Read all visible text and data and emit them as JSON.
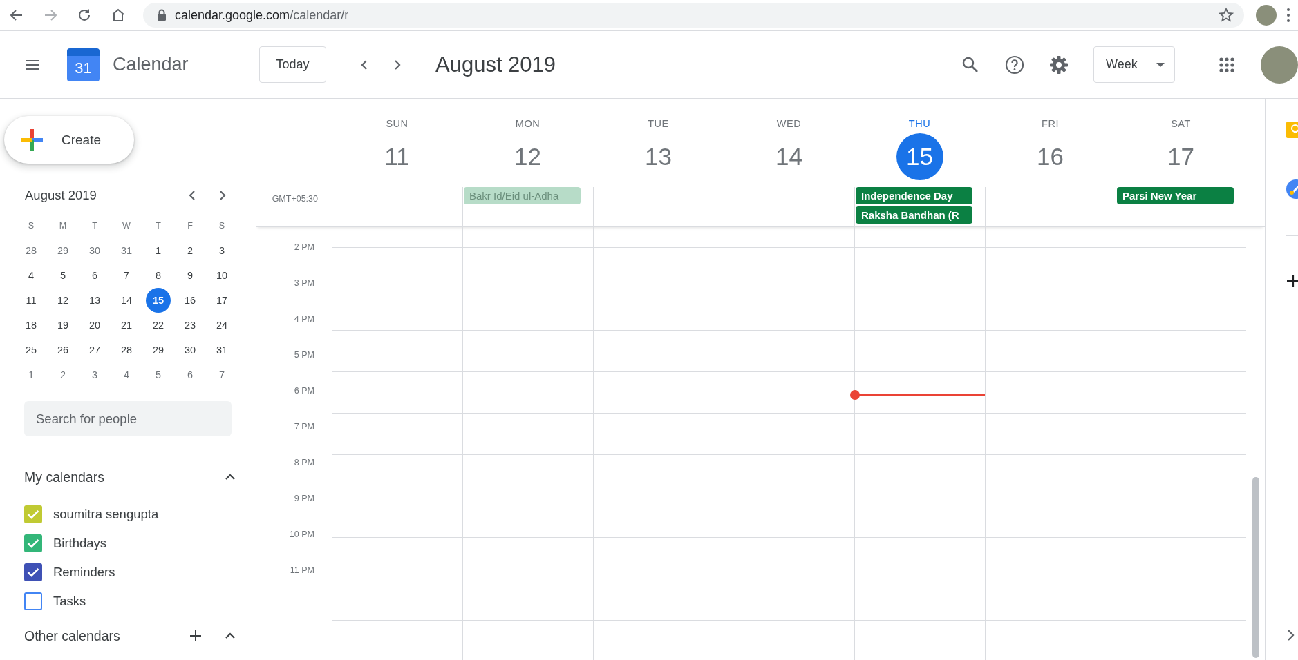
{
  "browser": {
    "url_host": "calendar.google.com",
    "url_path": "/calendar/r"
  },
  "header": {
    "logo_day": "31",
    "app_name": "Calendar",
    "today_button": "Today",
    "title": "August 2019",
    "view": "Week"
  },
  "sidebar": {
    "create_button": "Create",
    "mini_calendar": {
      "title": "August 2019",
      "weekdays": [
        "S",
        "M",
        "T",
        "W",
        "T",
        "F",
        "S"
      ],
      "weeks": [
        [
          {
            "day": "28",
            "in_month": false,
            "selected": false
          },
          {
            "day": "29",
            "in_month": false,
            "selected": false
          },
          {
            "day": "30",
            "in_month": false,
            "selected": false
          },
          {
            "day": "31",
            "in_month": false,
            "selected": false
          },
          {
            "day": "1",
            "in_month": true,
            "selected": false
          },
          {
            "day": "2",
            "in_month": true,
            "selected": false
          },
          {
            "day": "3",
            "in_month": true,
            "selected": false
          }
        ],
        [
          {
            "day": "4",
            "in_month": true,
            "selected": false
          },
          {
            "day": "5",
            "in_month": true,
            "selected": false
          },
          {
            "day": "6",
            "in_month": true,
            "selected": false
          },
          {
            "day": "7",
            "in_month": true,
            "selected": false
          },
          {
            "day": "8",
            "in_month": true,
            "selected": false
          },
          {
            "day": "9",
            "in_month": true,
            "selected": false
          },
          {
            "day": "10",
            "in_month": true,
            "selected": false
          }
        ],
        [
          {
            "day": "11",
            "in_month": true,
            "selected": false
          },
          {
            "day": "12",
            "in_month": true,
            "selected": false
          },
          {
            "day": "13",
            "in_month": true,
            "selected": false
          },
          {
            "day": "14",
            "in_month": true,
            "selected": false
          },
          {
            "day": "15",
            "in_month": true,
            "selected": true
          },
          {
            "day": "16",
            "in_month": true,
            "selected": false
          },
          {
            "day": "17",
            "in_month": true,
            "selected": false
          }
        ],
        [
          {
            "day": "18",
            "in_month": true,
            "selected": false
          },
          {
            "day": "19",
            "in_month": true,
            "selected": false
          },
          {
            "day": "20",
            "in_month": true,
            "selected": false
          },
          {
            "day": "21",
            "in_month": true,
            "selected": false
          },
          {
            "day": "22",
            "in_month": true,
            "selected": false
          },
          {
            "day": "23",
            "in_month": true,
            "selected": false
          },
          {
            "day": "24",
            "in_month": true,
            "selected": false
          }
        ],
        [
          {
            "day": "25",
            "in_month": true,
            "selected": false
          },
          {
            "day": "26",
            "in_month": true,
            "selected": false
          },
          {
            "day": "27",
            "in_month": true,
            "selected": false
          },
          {
            "day": "28",
            "in_month": true,
            "selected": false
          },
          {
            "day": "29",
            "in_month": true,
            "selected": false
          },
          {
            "day": "30",
            "in_month": true,
            "selected": false
          },
          {
            "day": "31",
            "in_month": true,
            "selected": false
          }
        ],
        [
          {
            "day": "1",
            "in_month": false,
            "selected": false
          },
          {
            "day": "2",
            "in_month": false,
            "selected": false
          },
          {
            "day": "3",
            "in_month": false,
            "selected": false
          },
          {
            "day": "4",
            "in_month": false,
            "selected": false
          },
          {
            "day": "5",
            "in_month": false,
            "selected": false
          },
          {
            "day": "6",
            "in_month": false,
            "selected": false
          },
          {
            "day": "7",
            "in_month": false,
            "selected": false
          }
        ]
      ]
    },
    "search": {
      "placeholder": "Search for people"
    },
    "my_calendars": {
      "title": "My calendars",
      "expanded": true,
      "items": [
        {
          "name": "soumitra sengupta",
          "checked": true,
          "color": "#c0ca33"
        },
        {
          "name": "Birthdays",
          "checked": true,
          "color": "#33b679"
        },
        {
          "name": "Reminders",
          "checked": true,
          "color": "#3f51b5"
        },
        {
          "name": "Tasks",
          "checked": false,
          "color": "#4285f4"
        }
      ]
    },
    "other_calendars": {
      "title": "Other calendars",
      "expanded": true
    }
  },
  "week": {
    "timezone": "GMT+05:30",
    "days": [
      {
        "name": "SUN",
        "number": "11",
        "selected": false
      },
      {
        "name": "MON",
        "number": "12",
        "selected": false,
        "events": [
          {
            "title": "Bakr Id/Eid ul-Adha",
            "dimmed": true
          }
        ]
      },
      {
        "name": "TUE",
        "number": "13",
        "selected": false
      },
      {
        "name": "WED",
        "number": "14",
        "selected": false
      },
      {
        "name": "THU",
        "number": "15",
        "selected": true,
        "events": [
          {
            "title": "Independence Day",
            "dimmed": false
          },
          {
            "title": "Raksha Bandhan (R",
            "dimmed": false
          }
        ]
      },
      {
        "name": "FRI",
        "number": "16",
        "selected": false
      },
      {
        "name": "SAT",
        "number": "17",
        "selected": false,
        "events": [
          {
            "title": "Parsi New Year",
            "dimmed": false
          }
        ]
      }
    ],
    "hours": [
      "2 PM",
      "3 PM",
      "4 PM",
      "5 PM",
      "6 PM",
      "7 PM",
      "8 PM",
      "9 PM",
      "10 PM",
      "11 PM"
    ]
  }
}
